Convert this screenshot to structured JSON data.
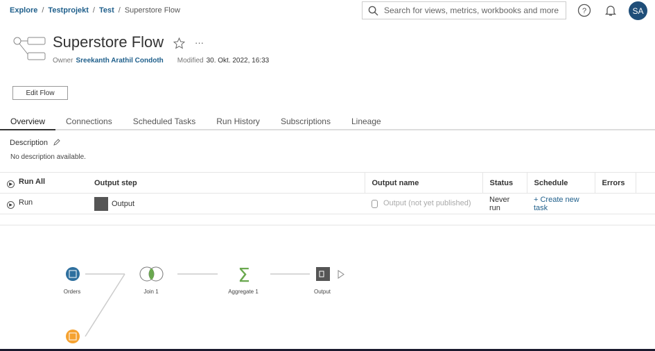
{
  "breadcrumb": [
    "Explore",
    "Testprojekt",
    "Test",
    "Superstore Flow"
  ],
  "search": {
    "placeholder": "Search for views, metrics, workbooks and more"
  },
  "user": {
    "initials": "SA"
  },
  "header": {
    "title": "Superstore Flow",
    "owner_label": "Owner",
    "owner": "Sreekanth Arathil Condoth",
    "modified_label": "Modified",
    "modified": "30. Okt. 2022, 16:33",
    "more": "···"
  },
  "edit_button": "Edit Flow",
  "tabs": [
    "Overview",
    "Connections",
    "Scheduled Tasks",
    "Run History",
    "Subscriptions",
    "Lineage"
  ],
  "description": {
    "label": "Description",
    "text": "No description available."
  },
  "table": {
    "run_all": "Run All",
    "headers": [
      "Output step",
      "Output name",
      "Status",
      "Schedule",
      "Errors"
    ],
    "rows": [
      {
        "run": "Run",
        "step": "Output",
        "name": "Output (not yet published)",
        "status": "Never run",
        "schedule": "+ Create new task",
        "errors": ""
      }
    ]
  },
  "flow": {
    "nodes": [
      "Orders",
      "Join 1",
      "Aggregate 1",
      "Output"
    ]
  },
  "colors": {
    "accent": "#1f5f8b",
    "orders": "#2e6f9e",
    "source2": "#f5a230",
    "join": "#6aa84f"
  }
}
